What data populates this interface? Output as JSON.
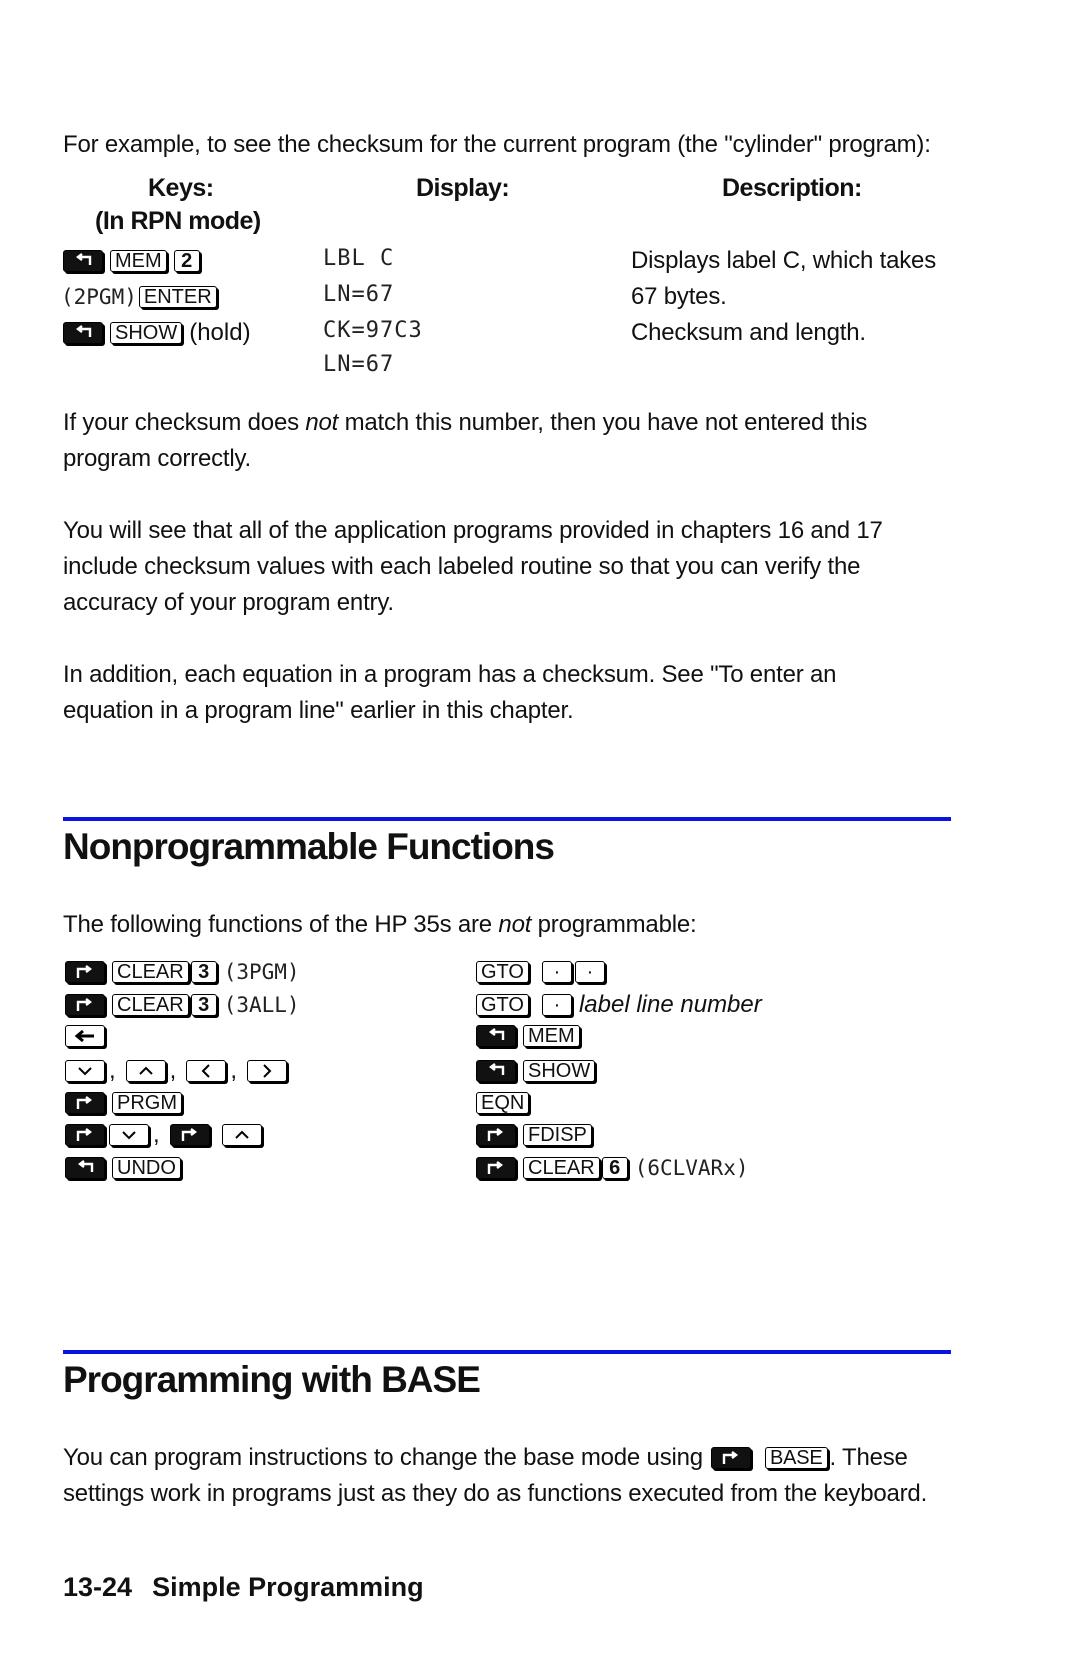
{
  "intro": "For example, to see the checksum for the current program (the \"cylinder\" program):",
  "table": {
    "headers": {
      "keys": "Keys:",
      "keys_sub": "(In RPN mode)",
      "display": "Display:",
      "description": "Description:"
    },
    "rows": [
      {
        "keys": [
          {
            "type": "shift",
            "icon": "left-shift-icon"
          },
          {
            "type": "key",
            "label": "MEM"
          },
          {
            "type": "key",
            "label": "2",
            "bold": true
          }
        ],
        "display": "LBL C",
        "description": "Displays label C, which takes"
      },
      {
        "keys_prefix": "(2PGM)",
        "keys": [
          {
            "type": "key",
            "label": "ENTER"
          }
        ],
        "display": "LN=67",
        "description": "67 bytes."
      },
      {
        "keys": [
          {
            "type": "shift",
            "icon": "left-shift-icon"
          },
          {
            "type": "key",
            "label": "SHOW"
          }
        ],
        "keys_suffix": "(hold)",
        "display": "CK=97C3",
        "description": "Checksum and length."
      },
      {
        "display": "LN=67"
      }
    ]
  },
  "paragraphs": [
    {
      "before": "If your checksum does ",
      "emph": "not",
      "after": " match this number, then you have not entered this",
      "line2": "program correctly."
    },
    {
      "line1": "You will see that all of the application programs provided in chapters 16 and  17",
      "line2": "include checksum values with each labeled routine so that you can verify the",
      "line3": "accuracy of your program entry."
    },
    {
      "line1": "In addition, each equation in a program has a checksum. See \"To enter an",
      "line2": "equation in a program line\" earlier in this chapter."
    }
  ],
  "section1": {
    "title": "Nonprogrammable Functions",
    "intro_before": "The following functions of the HP 35s are ",
    "intro_emph": "not",
    "intro_after": " programmable:",
    "left": {
      "r1": {
        "clear": "CLEAR",
        "num": "3",
        "lcd": "(3PGM)"
      },
      "r2": {
        "clear": "CLEAR",
        "num": "3",
        "lcd": "(3ALL)"
      },
      "r3": {
        "icon": "backspace-icon"
      },
      "r4": {
        "sep": ","
      },
      "r5": {
        "label": "PRGM"
      },
      "r6": {
        "sep": ","
      },
      "r7": {
        "label": "UNDO"
      }
    },
    "right": {
      "r1": {
        "gto": "GTO"
      },
      "r2": {
        "gto": "GTO",
        "text": "label line number"
      },
      "r3": {
        "label": "MEM"
      },
      "r4": {
        "label": "SHOW"
      },
      "r5": {
        "label": "EQN"
      },
      "r6": {
        "label": "FDISP"
      },
      "r7": {
        "clear": "CLEAR",
        "num": "6",
        "lcd": "(6CLVARx)"
      }
    }
  },
  "section2": {
    "title": "Programming with BASE",
    "line1_before": "You can program instructions to change the base mode using",
    "key_label": "BASE",
    "line1_after": ". These",
    "line2": "settings work in programs just as they do as functions executed from the keyboard."
  },
  "footer": {
    "page": "13-24",
    "chapter": "Simple Programming"
  },
  "colors": {
    "rule": "#0a14e0",
    "text": "#111111"
  }
}
